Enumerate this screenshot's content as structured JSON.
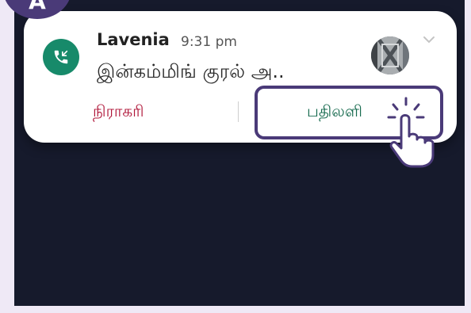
{
  "step": {
    "label": "A"
  },
  "notification": {
    "app_icon": "incoming-call-icon",
    "caller": "Lavenia",
    "time": "9:31 pm",
    "message": "இன்கம்மிங் குரல் அ..",
    "avatar": "contact-avatar",
    "expand_icon": "chevron-down-icon",
    "actions": {
      "decline": "நிராகரி",
      "answer": "பதிலளி"
    }
  },
  "cursor": {
    "icon": "hand-pointer-icon"
  },
  "colors": {
    "accent": "#4a3a78",
    "decline": "#b0173a",
    "answer": "#176b4f",
    "app_icon_bg": "#178a6a",
    "screen_bg": "#161a2c"
  }
}
